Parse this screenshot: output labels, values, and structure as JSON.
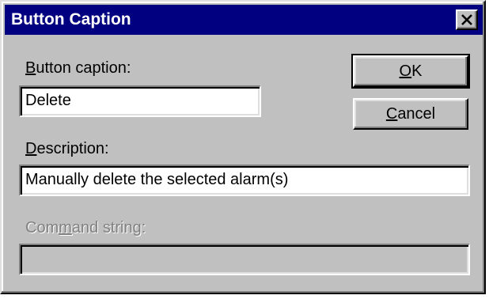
{
  "window": {
    "title": "Button Caption",
    "close_icon": "close-x-icon"
  },
  "caption": {
    "label_accel": "B",
    "label_rest": "utton caption:",
    "value": "Delete"
  },
  "description": {
    "label_accel": "D",
    "label_rest": "escription:",
    "value": "Manually delete the selected alarm(s)"
  },
  "command": {
    "label_pre": "Com",
    "label_accel": "m",
    "label_rest": "and string:",
    "value": "",
    "disabled": true
  },
  "buttons": {
    "ok_accel": "O",
    "ok_rest": "K",
    "cancel_accel": "C",
    "cancel_rest": "ancel"
  },
  "colors": {
    "titlebar": "#000080",
    "face": "#c0c0c0",
    "disabled_text": "#808080"
  }
}
